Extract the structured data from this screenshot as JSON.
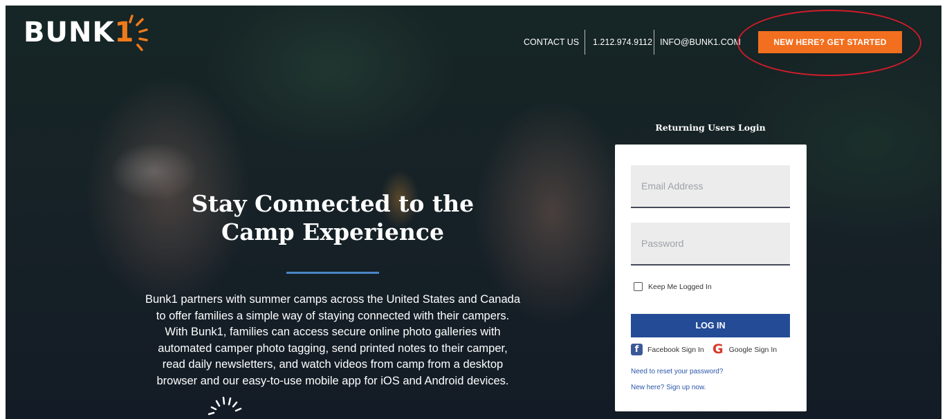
{
  "brand": {
    "logo_text": "BUNK",
    "logo_number": "1",
    "accent": "#f26f1f"
  },
  "nav": {
    "contact": "CONTACT US",
    "phone": "1.212.974.9112",
    "email": "INFO@BUNK1.COM",
    "cta": "NEW HERE? GET STARTED"
  },
  "hero": {
    "headline_line1": "Stay Connected to the",
    "headline_line2": "Camp Experience",
    "description_lines": [
      "Bunk1 partners with summer camps across the United States and Canada",
      "to offer families a simple way of staying connected with their campers.",
      "With Bunk1, families can access secure online photo galleries with",
      "automated camper photo tagging, send printed notes to their camper,",
      "read daily newsletters, and watch videos from camp from a desktop",
      "browser and our easy-to-use mobile app for iOS and Android devices."
    ]
  },
  "login": {
    "title": "Returning Users Login",
    "email_placeholder": "Email Address",
    "password_placeholder": "Password",
    "remember_label": "Keep Me Logged In",
    "submit_label": "LOG IN",
    "facebook_label": "Facebook Sign In",
    "google_label": "Google Sign In",
    "reset_link": "Need to reset your password?",
    "signup_link": "New here? Sign up now.",
    "button_color": "#234b96"
  },
  "icons": [
    "sun-rays-icon",
    "facebook-icon",
    "google-icon",
    "checkbox-icon",
    "loading-spinner-icon"
  ]
}
